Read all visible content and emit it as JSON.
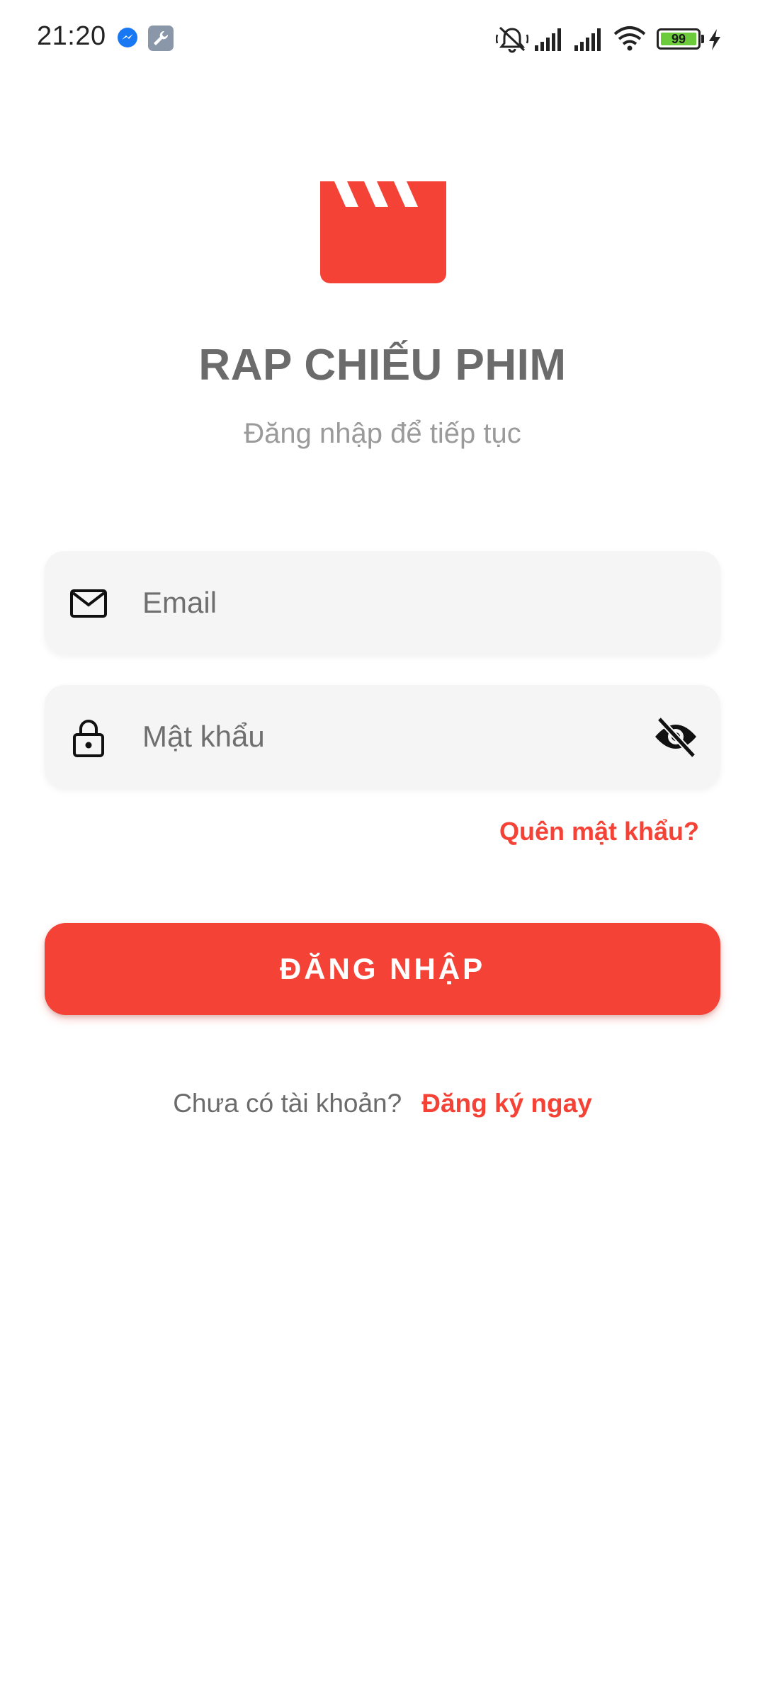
{
  "status_bar": {
    "time": "21:20",
    "left_icons": [
      "messenger-icon",
      "wrench-icon"
    ],
    "right_icons": [
      "muted-bell-icon",
      "signal-icon",
      "signal-icon",
      "wifi-icon",
      "battery-icon",
      "charging-icon"
    ],
    "battery_level": "99"
  },
  "app": {
    "title": "RAP CHIẾU PHIM",
    "subtitle": "Đăng nhập để tiếp tục",
    "logo_icon": "clapperboard-icon"
  },
  "form": {
    "email": {
      "placeholder": "Email",
      "value": "",
      "icon": "mail-icon"
    },
    "password": {
      "placeholder": "Mật khẩu",
      "value": "",
      "icon": "lock-icon",
      "toggle_icon": "eye-off-icon"
    },
    "forgot_label": "Quên mật khẩu?",
    "login_label": "ĐĂNG NHẬP"
  },
  "signup": {
    "prompt": "Chưa có tài khoản?",
    "link": "Đăng ký ngay"
  },
  "colors": {
    "accent": "#f44336",
    "title": "#6b6b6b",
    "subtitle": "#9a9a9a",
    "field_bg": "#f5f5f5"
  }
}
